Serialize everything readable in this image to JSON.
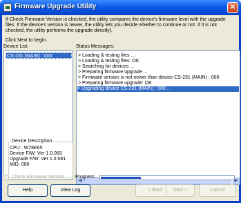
{
  "window": {
    "title": "Firmware Upgrade Utility",
    "close_glyph": "✕"
  },
  "intro": {
    "text": "If Check Firmware Version is checked, the utility compares the device's firmware level with the upgrade files. If the device's version is newer, the utility lets you decide whether to continue or not. If it is not checked, the utility performs the upgrade directly).",
    "prompt": "Click Next to begin."
  },
  "device_list": {
    "label": "Device List:",
    "items": [
      "CS-231 (MAIN) : 000"
    ],
    "selected_index": 0
  },
  "device_description": {
    "legend": "Device Description",
    "lines": [
      "CPU : W78E65",
      "Device F/W: Ver 1.0.083",
      "Upgrade F/W: Ver 1.0.081",
      "MID: 000"
    ]
  },
  "status": {
    "label": "Status Messages:",
    "messages": [
      "> Loading & testing files ...",
      "> Loading & testing files: OK",
      "> Searching for devices ...",
      "> Preparing firmware upgrade ...",
      "> Firmware version is not newer than device CS-231 (MAIN) : 000",
      "> Preparing firmware upgrade: OK",
      "> Upgrading device CS-231 (MAIN) : 000 ..."
    ],
    "selected_index": 6
  },
  "check_firmware": {
    "label": "Check Firmware Version",
    "checked": true,
    "enabled": false,
    "check_glyph": "✓"
  },
  "progress": {
    "label": "Progress...",
    "fraction": 0.3
  },
  "scrollbar": {
    "left_glyph": "◀",
    "right_glyph": "▶"
  },
  "buttons": {
    "help": "Help",
    "view_log": "View Log",
    "back": "< Back",
    "next": "Next >",
    "cancel": "Cancel"
  },
  "colors": {
    "selection": "#316ac5",
    "titlebar": "#0a5be8",
    "progress": "#1f4fc1"
  }
}
